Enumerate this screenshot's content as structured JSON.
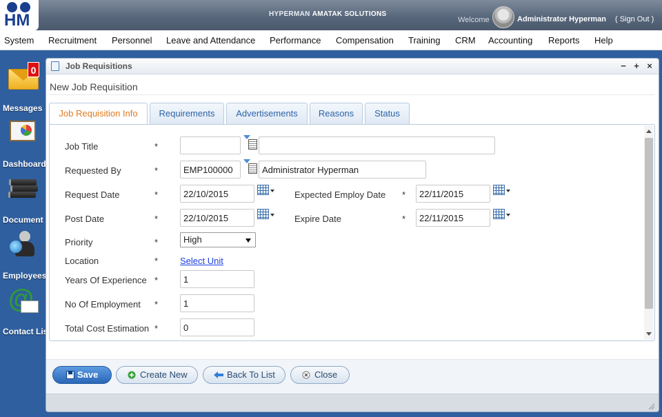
{
  "header": {
    "logo_text": "HM",
    "brand_prefix": "HYPERMAN ",
    "brand_name": "AMATAK SOLUTIONS",
    "welcome": "Welcome",
    "username": "Administrator Hyperman",
    "signout": "( Sign Out )"
  },
  "menu": [
    "System",
    "Recruitment",
    "Personnel",
    "Leave and Attendance",
    "Performance",
    "Compensation",
    "Training",
    "CRM",
    "Accounting",
    "Reports",
    "Help"
  ],
  "dock": {
    "messages": {
      "label": "Messages",
      "badge": "0"
    },
    "dashboard": {
      "label": "Dashboard"
    },
    "document": {
      "label": "Document L"
    },
    "employees": {
      "label": "Employees"
    },
    "contact": {
      "label": "Contact Lis"
    }
  },
  "window": {
    "title": "Job Requisitions",
    "heading": "New Job Requisition",
    "controls": {
      "minimize": "−",
      "maximize": "+",
      "close": "×"
    }
  },
  "tabs": [
    "Job Requisition Info",
    "Requirements",
    "Advertisements",
    "Reasons",
    "Status"
  ],
  "form": {
    "required_mark": "*",
    "job_title": {
      "label": "Job Title",
      "code": "",
      "name": ""
    },
    "requested_by": {
      "label": "Requested By",
      "code": "EMP100000",
      "name": "Administrator Hyperman"
    },
    "request_date": {
      "label": "Request Date",
      "value": "22/10/2015"
    },
    "expected_employ_date": {
      "label": "Expected Employ Date",
      "value": "22/11/2015"
    },
    "post_date": {
      "label": "Post Date",
      "value": "22/10/2015"
    },
    "expire_date": {
      "label": "Expire Date",
      "value": "22/11/2015"
    },
    "priority": {
      "label": "Priority",
      "value": "High"
    },
    "location": {
      "label": "Location",
      "link": "Select Unit"
    },
    "years_experience": {
      "label": "Years Of Experience",
      "value": "1"
    },
    "no_employment": {
      "label": "No Of Employment",
      "value": "1"
    },
    "total_cost": {
      "label": "Total Cost Estimation",
      "value": "0"
    }
  },
  "buttons": {
    "save": "Save",
    "create_new": "Create New",
    "back": "Back To List",
    "close": "Close"
  },
  "colors": {
    "accent_tab": "#e07b20",
    "link": "#1a3ee0",
    "primary_button": "#2a66b8",
    "badge": "#e01010"
  }
}
